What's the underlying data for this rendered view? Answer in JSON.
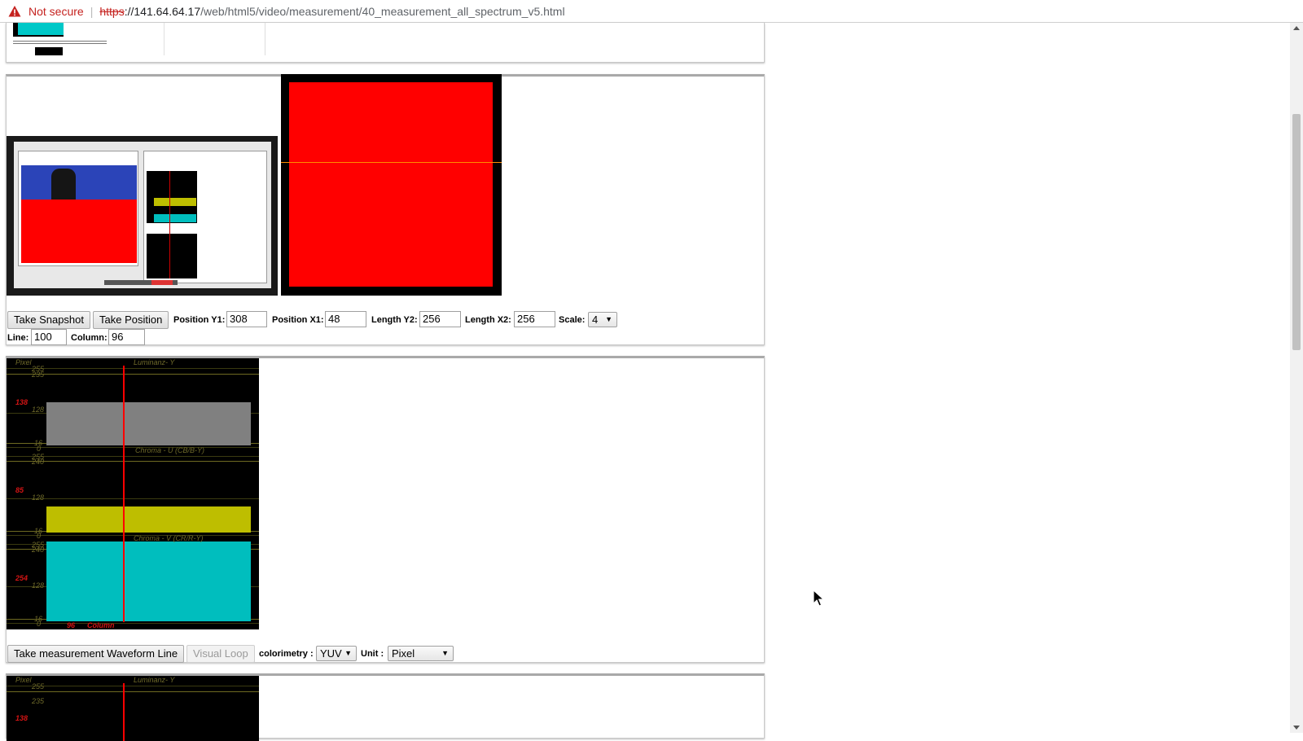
{
  "browser": {
    "security_label": "Not secure",
    "url_scheme": "https",
    "url_host": "://141.64.64.17",
    "url_path": "/web/html5/video/measurement/40_measurement_all_spectrum_v5.html"
  },
  "video_panel": {
    "buttons": {
      "snapshot": "Take Snapshot",
      "position": "Take Position"
    },
    "fields": {
      "pos_y1_label": "Position Y1:",
      "pos_y1": "308",
      "pos_x1_label": "Position X1:",
      "pos_x1": "48",
      "len_y2_label": "Length Y2:",
      "len_y2": "256",
      "len_x2_label": "Length X2:",
      "len_x2": "256",
      "scale_label": "Scale:",
      "scale": "4",
      "line_label": "Line:",
      "line": "100",
      "column_label": "Column:",
      "column": "96"
    }
  },
  "waveform": {
    "pixel_label": "Pixel",
    "luma_title": "Luminanz- Y",
    "chroma_u_title": "Chroma - U (CB/B-Y)",
    "chroma_v_title": "Chroma - V (CR/R-Y)",
    "column_label": "Column",
    "column_value": "96",
    "luma_ticks": [
      "255",
      "235",
      "128",
      "16",
      "0"
    ],
    "luma_value": "138",
    "u_ticks": [
      "255",
      "240",
      "128",
      "16",
      "0"
    ],
    "u_value": "85",
    "v_ticks": [
      "255",
      "240",
      "128",
      "16",
      "0"
    ],
    "v_value": "254",
    "colors": {
      "luma_bar": "#808080",
      "u_bar": "#bebe00",
      "v_bar": "#00bebe",
      "cursor": "#ff0000"
    }
  },
  "wave_controls": {
    "measure_button": "Take measurement Waveform Line",
    "loop_button": "Visual Loop",
    "colorimetry_label": "colorimetry :",
    "colorimetry_value": "YUV",
    "unit_label": "Unit :",
    "unit_value": "Pixel"
  },
  "bottom_panel": {
    "pixel_label": "Pixel",
    "luma_title": "Luminanz- Y",
    "ticks": [
      "255",
      "235",
      "138"
    ]
  }
}
